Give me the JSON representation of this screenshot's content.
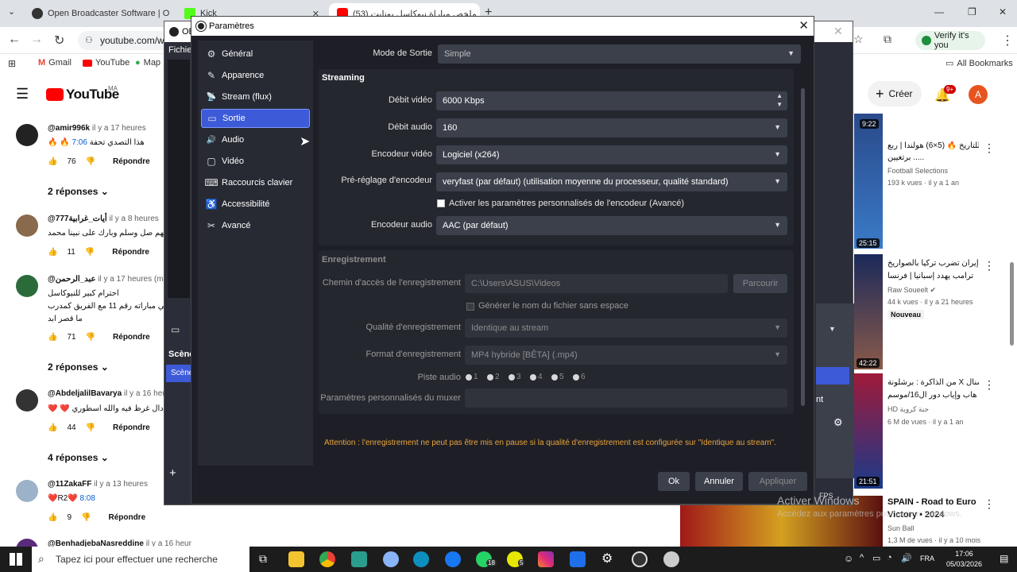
{
  "browser": {
    "tabs": [
      {
        "title": "Open Broadcaster Software | O"
      },
      {
        "title": "Kick"
      },
      {
        "title": "(53) ملخص مباراة نيوكاسل يونايت"
      }
    ],
    "new_tab": "+",
    "address": "youtube.com/w",
    "verify_label": "Verify it's you",
    "bookmarks": [
      "Gmail",
      "YouTube",
      "Map"
    ],
    "all_bookmarks": "All Bookmarks"
  },
  "youtube": {
    "logo": "YouTube",
    "region": "MA",
    "create_label": "Créer",
    "notif_badge": "9+",
    "account_initial": "A",
    "comments": [
      {
        "user": "@amir996k",
        "time": "il y a 17 heures",
        "text": "🔥 🔥 هذا التصدي تحفة",
        "timestamp": "7:06",
        "likes": "76",
        "reply": "Répondre",
        "replies": "2 réponses"
      },
      {
        "user": "@777أيات_غرابية",
        "time": "il y a 8 heures",
        "text": "اللهم صل وسلم وبارك على نبينا محمد",
        "timestamp": "0:",
        "likes": "11",
        "reply": "Répondre"
      },
      {
        "user": "@عبد_الرحمن",
        "time": "il y a 17 heures (modi",
        "text": "احترام كبير للنيوكاسل",
        "text2": "ك في مباراته رقم 11 مع الفريق كمدرب",
        "text3": "ما قصر ابد",
        "likes": "71",
        "reply": "Répondre",
        "replies": "2 réponses"
      },
      {
        "user": "@AbdeljalilBavarya",
        "time": "il y a 16 heur",
        "text": "❤️ ❤️ دال غرظ فيه والله اسطوري",
        "likes": "44",
        "reply": "Répondre",
        "replies": "4 réponses"
      },
      {
        "user": "@11ZakaFF",
        "time": "il y a 13 heures",
        "text": "❤️R2❤️",
        "timestamp": "8:08",
        "likes": "9",
        "reply": "Répondre"
      },
      {
        "user": "@BenhadjebaNasreddine",
        "time": "il y a 16 heur"
      }
    ],
    "videos": [
      {
        "duration_top": "9:22",
        "title": "مباراة للتاريخ 🔥 (5×6) هولندا | ربع",
        "title2": "برتغيين .....",
        "channel": "Football Selections",
        "meta": "193 k vues · il y a 1 an",
        "duration": "25:15"
      },
      {
        "title": "إيران تضرب تركيا بالصواريخ",
        "title2": "ترامب يهدد إسبانيا | فرنسا",
        "channel": "Raw Soueelt",
        "meta": "44 k vues · il y a 21 heures",
        "badge": "Nouveau",
        "duration": "42:22"
      },
      {
        "title": "من الذاكرة : برشلونة X أرسنال",
        "title2": "هاب وإياب دور ال16/موسم",
        "channel": "HD جنة كروية",
        "meta": "6 M de vues · il y a 1 an",
        "duration": "21:51"
      },
      {
        "title": "SPAIN - Road to Euro",
        "title2": "Victory • 2024",
        "channel": "Sun Ball",
        "meta": "1,3 M de vues · il y a 10 mois"
      }
    ]
  },
  "obs_main": {
    "title": "OB",
    "menu_file": "Fichie",
    "scenes_header": "Scène",
    "scene_item": "Scène",
    "stats_fps": "FPS",
    "right_label": "nt"
  },
  "dialog": {
    "title": "Paramètres",
    "close": "✕",
    "sidebar": [
      {
        "label": "Général",
        "icon": "gear-icon",
        "glyph": "⚙"
      },
      {
        "label": "Apparence",
        "icon": "appearance-icon",
        "glyph": "✎"
      },
      {
        "label": "Stream (flux)",
        "icon": "antenna-icon",
        "glyph": "📡"
      },
      {
        "label": "Sortie",
        "icon": "output-icon",
        "glyph": "▭",
        "selected": true
      },
      {
        "label": "Audio",
        "icon": "speaker-icon",
        "glyph": "🔊"
      },
      {
        "label": "Vidéo",
        "icon": "monitor-icon",
        "glyph": "▢"
      },
      {
        "label": "Raccourcis clavier",
        "icon": "keyboard-icon",
        "glyph": "⌨"
      },
      {
        "label": "Accessibilité",
        "icon": "accessibility-icon",
        "glyph": "♿"
      },
      {
        "label": "Avancé",
        "icon": "tools-icon",
        "glyph": "✂"
      }
    ],
    "output_mode_label": "Mode de Sortie",
    "output_mode_value": "Simple",
    "streaming": {
      "header": "Streaming",
      "video_bitrate_label": "Débit vidéo",
      "video_bitrate_value": "6000 Kbps",
      "audio_bitrate_label": "Débit audio",
      "audio_bitrate_value": "160",
      "video_encoder_label": "Encodeur vidéo",
      "video_encoder_value": "Logiciel (x264)",
      "preset_label": "Pré-réglage d'encodeur",
      "preset_value": "veryfast (par défaut) (utilisation moyenne du processeur, qualité standard)",
      "custom_checkbox_label": "Activer les paramètres personnalisés de l'encodeur (Avancé)",
      "audio_encoder_label": "Encodeur audio",
      "audio_encoder_value": "AAC (par défaut)"
    },
    "recording": {
      "header": "Enregistrement",
      "path_label": "Chemin d'accès de l'enregistrement",
      "path_value": "C:\\Users\\ASUS\\Videos",
      "browse_label": "Parcourir",
      "nospace_label": "Générer le nom du fichier sans espace",
      "quality_label": "Qualité d'enregistrement",
      "quality_value": "Identique au stream",
      "format_label": "Format d'enregistrement",
      "format_value": "MP4 hybride [BÊTA] (.mp4)",
      "tracks_label": "Piste audio",
      "tracks": [
        "1",
        "2",
        "3",
        "4",
        "5",
        "6"
      ],
      "muxer_label": "Paramètres personnalisés du muxer"
    },
    "warning": "Attention : l'enregistrement ne peut pas être mis en pause si la qualité d'enregistrement est configurée sur \"Identique au stream\".",
    "ok_label": "Ok",
    "cancel_label": "Annuler",
    "apply_label": "Appliquer"
  },
  "taskbar": {
    "search_placeholder": "Tapez ici pour effectuer une recherche",
    "whatsapp_badge": "18",
    "badge2": "5",
    "lang": "FRA",
    "time": "17:06",
    "date": "05/03/2026"
  },
  "watermark": {
    "line1": "Activer Windows",
    "line2": "Accédez aux paramètres pour activer Windows."
  },
  "colors": {
    "accent": "#3d5ad8",
    "warning": "#e8a33b",
    "dialog_bg": "#1e1f26",
    "youtube_red": "#ff0000"
  }
}
